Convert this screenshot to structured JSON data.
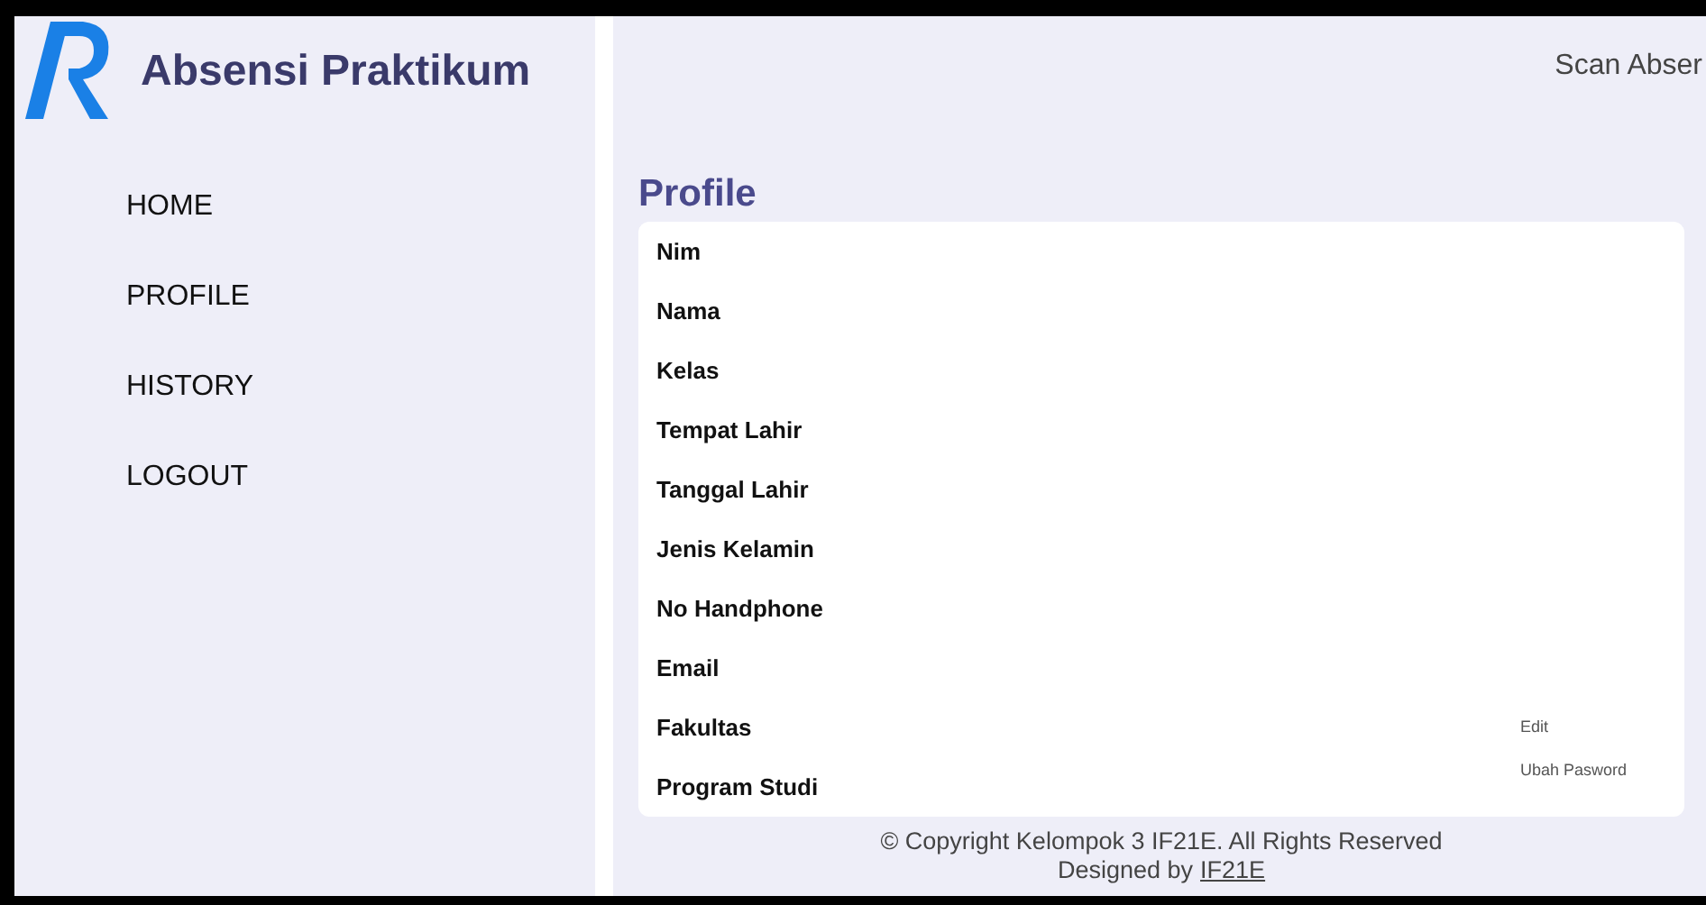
{
  "app": {
    "title": "Absensi Praktikum"
  },
  "sidebar": {
    "items": [
      {
        "label": "HOME"
      },
      {
        "label": "PROFILE"
      },
      {
        "label": "HISTORY"
      },
      {
        "label": "LOGOUT"
      }
    ]
  },
  "header": {
    "link": "Scan Abser"
  },
  "profile": {
    "title": "Profile",
    "fields": [
      "Nim",
      "Nama",
      "Kelas",
      "Tempat Lahir",
      "Tanggal Lahir",
      "Jenis Kelamin",
      "No Handphone",
      "Email",
      "Fakultas",
      "Program Studi"
    ],
    "actions": [
      "Edit",
      "Ubah Pasword"
    ]
  },
  "footer": {
    "copyright": "© Copyright Kelompok 3 IF21E. All Rights Reserved",
    "designed_by": "Designed by",
    "designer_link": "IF21E"
  }
}
